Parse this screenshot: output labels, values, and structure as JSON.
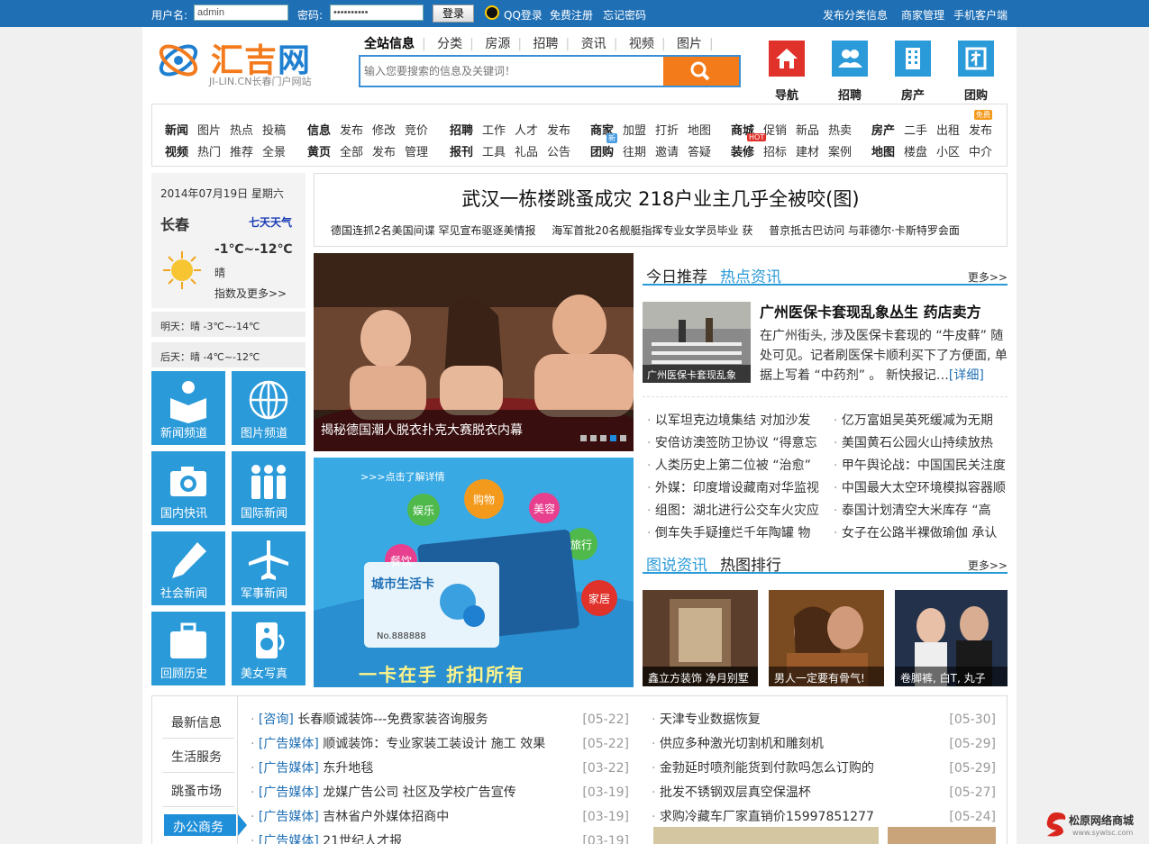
{
  "topbar": {
    "user_label": "用户名:",
    "user_value": "admin",
    "pwd_label": "密码:",
    "pwd_value": "••••••••••",
    "login_button": "登录",
    "qq_login": "QQ登录",
    "register": "免费注册",
    "forgot": "忘记密码",
    "right_links": [
      "发布分类信息",
      "商家管理",
      "手机客户端"
    ]
  },
  "logo": {
    "cn_a": "汇吉",
    "cn_b": "网",
    "sub": "JI-LIN.CN长春门户网站"
  },
  "search": {
    "tabs": [
      "全站信息",
      "分类",
      "房源",
      "招聘",
      "资讯",
      "视频",
      "图片"
    ],
    "placeholder": "输入您要搜索的信息及关键词！"
  },
  "quick_icons": [
    "导航",
    "招聘",
    "房产",
    "团购"
  ],
  "catnav": {
    "groups": [
      {
        "row1": [
          "新闻",
          "图片",
          "热点",
          "投稿"
        ],
        "row2": [
          "视频",
          "热门",
          "推荐",
          "全景"
        ]
      },
      {
        "row1": [
          "信息",
          "发布",
          "修改",
          "竞价"
        ],
        "row2": [
          "黄页",
          "全部",
          "发布",
          "管理"
        ]
      },
      {
        "row1": [
          "招聘",
          "工作",
          "人才",
          "发布"
        ],
        "row2": [
          "报刊",
          "工具",
          "礼品",
          "公告"
        ]
      },
      {
        "row1": [
          "商家",
          "加盟",
          "打折",
          "地图"
        ],
        "row2": [
          "团购",
          "往期",
          "邀请",
          "答疑"
        ]
      },
      {
        "row1": [
          "商城",
          "促销",
          "新品",
          "热卖"
        ],
        "row2": [
          "装修",
          "招标",
          "建材",
          "案例"
        ]
      },
      {
        "row1": [
          "房产",
          "二手",
          "出租",
          "发布"
        ],
        "row2": [
          "地图",
          "楼盘",
          "小区",
          "中介"
        ]
      }
    ],
    "badge_new": "新",
    "badge_hot": "HOT",
    "badge_free": "免费"
  },
  "weather": {
    "date": "2014年07月19日  星期六",
    "city": "长春",
    "seven_day": "七天天气",
    "temp": "-1℃~-12℃",
    "cond": "晴",
    "more": "指数及更多>>",
    "tomorrow": "明天：晴 -3℃~-14℃",
    "after": "后天：晴 -4℃~-12℃"
  },
  "tiles": [
    "新闻频道",
    "图片频道",
    "国内快讯",
    "国际新闻",
    "社会新闻",
    "军事新闻",
    "回顾历史",
    "美女写真"
  ],
  "headline": {
    "title": "武汉一栋楼跳蚤成灾 218户业主几乎全被咬(图)",
    "subs": [
      "德国连抓2名美国间谍 罕见宣布驱逐美情报",
      "海军首批20名舰艇指挥专业女学员毕业 获",
      "普京抵古巴访问 与菲德尔·卡斯特罗会面"
    ]
  },
  "slide": {
    "caption": "揭秘德国潮人脱衣扑克大赛脱衣内幕",
    "dots": 5,
    "active": 4
  },
  "ad": {
    "link": ">>>点击了解详情",
    "bubbles": [
      "娱乐",
      "购物",
      "美容",
      "餐饮",
      "旅行",
      "家居"
    ],
    "card_title": "城市生活卡",
    "card_no": "No.888888",
    "slogan": "一卡在手 折扣所有"
  },
  "hot": {
    "tab_a": "今日推荐",
    "tab_b": "热点资讯",
    "more": "更多>>",
    "img_caption": "广州医保卡套现乱象",
    "title": "广州医保卡套现乱象丛生 药店卖方",
    "desc": "在广州街头, 涉及医保卡套现的 “牛皮藓” 随处可见。记者刷医保卡顺利买下了方便面, 单据上写着 “中药剂” 。 新快报记…",
    "detail": "[详细]",
    "left_list": [
      "以军坦克边境集结 对加沙发",
      "安倍访澳签防卫协议 “得意忘",
      "人类历史上第二位被 “治愈”",
      "外媒：印度增设藏南对华监视",
      "组图：湖北进行公交车火灾应",
      "倒车失手疑撞烂千年陶罐 物"
    ],
    "right_list": [
      "亿万富姐吴英死缓减为无期",
      "美国黄石公园火山持续放热",
      "甲午舆论战：中国国民关注度",
      "中国最大太空环境模拟容器顺",
      "泰国计划清空大米库存 “高",
      "女子在公路半裸做瑜伽 承认"
    ]
  },
  "pics": {
    "tab_a": "图说资讯",
    "tab_b": "热图排行",
    "more": "更多>>",
    "captions": [
      "鑫立方装饰 净月别墅",
      "男人一定要有骨气!",
      "卷脚裤, 白T, 丸子"
    ]
  },
  "bottom": {
    "tabs": [
      "最新信息",
      "生活服务",
      "跳蚤市场",
      "办公商务"
    ],
    "active_tab": 3,
    "left": [
      {
        "tag": "[咨询]",
        "text": "长春顺诚装饰---免费家装咨询服务",
        "date": "[05-22]"
      },
      {
        "tag": "[广告媒体]",
        "text": "顺诚装饰：专业家装工装设计 施工 效果",
        "date": "[05-22]"
      },
      {
        "tag": "[广告媒体]",
        "text": "东升地毯",
        "date": "[03-22]"
      },
      {
        "tag": "[广告媒体]",
        "text": "龙媒广告公司 社区及学校广告宣传",
        "date": "[03-19]"
      },
      {
        "tag": "[广告媒体]",
        "text": "吉林省户外媒体招商中",
        "date": "[03-19]"
      },
      {
        "tag": "[广告媒体]",
        "text": "21世纪人才报",
        "date": "[03-19]"
      }
    ],
    "right": [
      {
        "text": "天津专业数据恢复",
        "date": "[05-30]"
      },
      {
        "text": "供应多种激光切割机和雕刻机",
        "date": "[05-29]"
      },
      {
        "text": "金勃延时喷剂能货到付款吗怎么订购的",
        "date": "[05-29]"
      },
      {
        "text": "批发不锈钢双层真空保温杯",
        "date": "[05-27]"
      },
      {
        "text": "求购冷藏车厂家直销价15997851277",
        "date": "[05-24]"
      }
    ]
  },
  "watermark": {
    "name": "松原网络商城",
    "url": "www.sywlsc.com"
  },
  "colors": {
    "topbar": "#1f6fb5",
    "accent": "#2b9ad9",
    "orange": "#f47b1a",
    "red_icon": "#e0312a"
  }
}
